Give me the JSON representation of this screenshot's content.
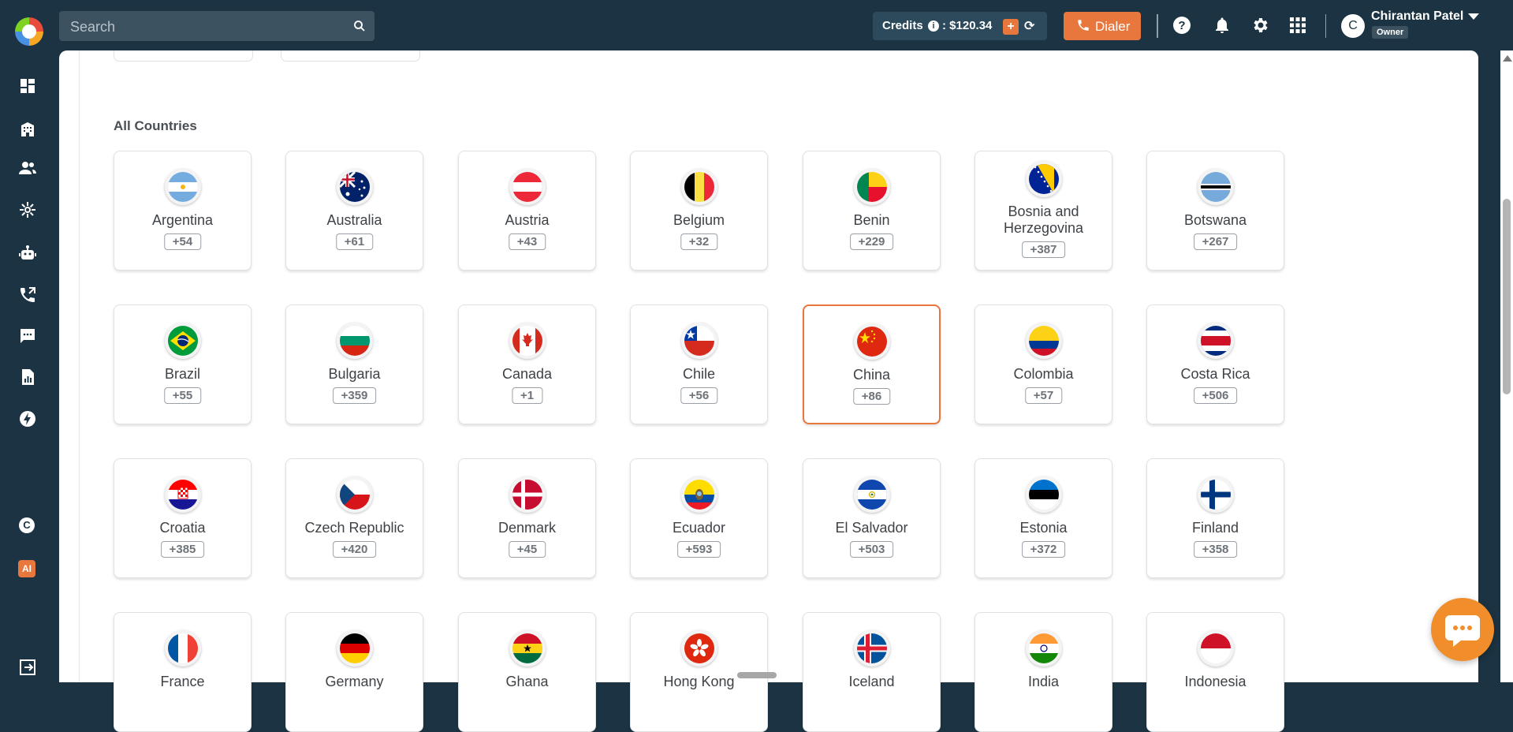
{
  "topbar": {
    "search_placeholder": "Search",
    "credits_label": "Credits",
    "credits_amount": ": $120.34",
    "dialer_label": "Dialer",
    "user_initial": "C",
    "user_name": "Chirantan Patel",
    "user_role": "Owner"
  },
  "sidebar": {
    "items": [
      "dashboard-icon",
      "building-icon",
      "contacts-icon",
      "integrations-icon",
      "bot-icon",
      "call-forward-icon",
      "chat-icon",
      "reports-icon",
      "flash-icon",
      "brand-icon",
      "ai-icon",
      "logout-icon"
    ],
    "ai_label": "AI"
  },
  "main": {
    "section_title": "All Countries",
    "countries": [
      {
        "name": "Argentina",
        "code": "+54"
      },
      {
        "name": "Australia",
        "code": "+61"
      },
      {
        "name": "Austria",
        "code": "+43"
      },
      {
        "name": "Belgium",
        "code": "+32"
      },
      {
        "name": "Benin",
        "code": "+229"
      },
      {
        "name": "Bosnia and Herzegovina",
        "code": "+387"
      },
      {
        "name": "Botswana",
        "code": "+267"
      },
      {
        "name": "Brazil",
        "code": "+55"
      },
      {
        "name": "Bulgaria",
        "code": "+359"
      },
      {
        "name": "Canada",
        "code": "+1"
      },
      {
        "name": "Chile",
        "code": "+56"
      },
      {
        "name": "China",
        "code": "+86",
        "selected": true
      },
      {
        "name": "Colombia",
        "code": "+57"
      },
      {
        "name": "Costa Rica",
        "code": "+506"
      },
      {
        "name": "Croatia",
        "code": "+385"
      },
      {
        "name": "Czech Republic",
        "code": "+420"
      },
      {
        "name": "Denmark",
        "code": "+45"
      },
      {
        "name": "Ecuador",
        "code": "+593"
      },
      {
        "name": "El Salvador",
        "code": "+503"
      },
      {
        "name": "Estonia",
        "code": "+372"
      },
      {
        "name": "Finland",
        "code": "+358"
      },
      {
        "name": "France",
        "code": ""
      },
      {
        "name": "Germany",
        "code": ""
      },
      {
        "name": "Ghana",
        "code": ""
      },
      {
        "name": "Hong Kong",
        "code": ""
      },
      {
        "name": "Iceland",
        "code": ""
      },
      {
        "name": "India",
        "code": ""
      },
      {
        "name": "Indonesia",
        "code": ""
      }
    ]
  },
  "colors": {
    "navy": "#1b3342",
    "accent": "#e8773d",
    "chat": "#f28d2c"
  }
}
